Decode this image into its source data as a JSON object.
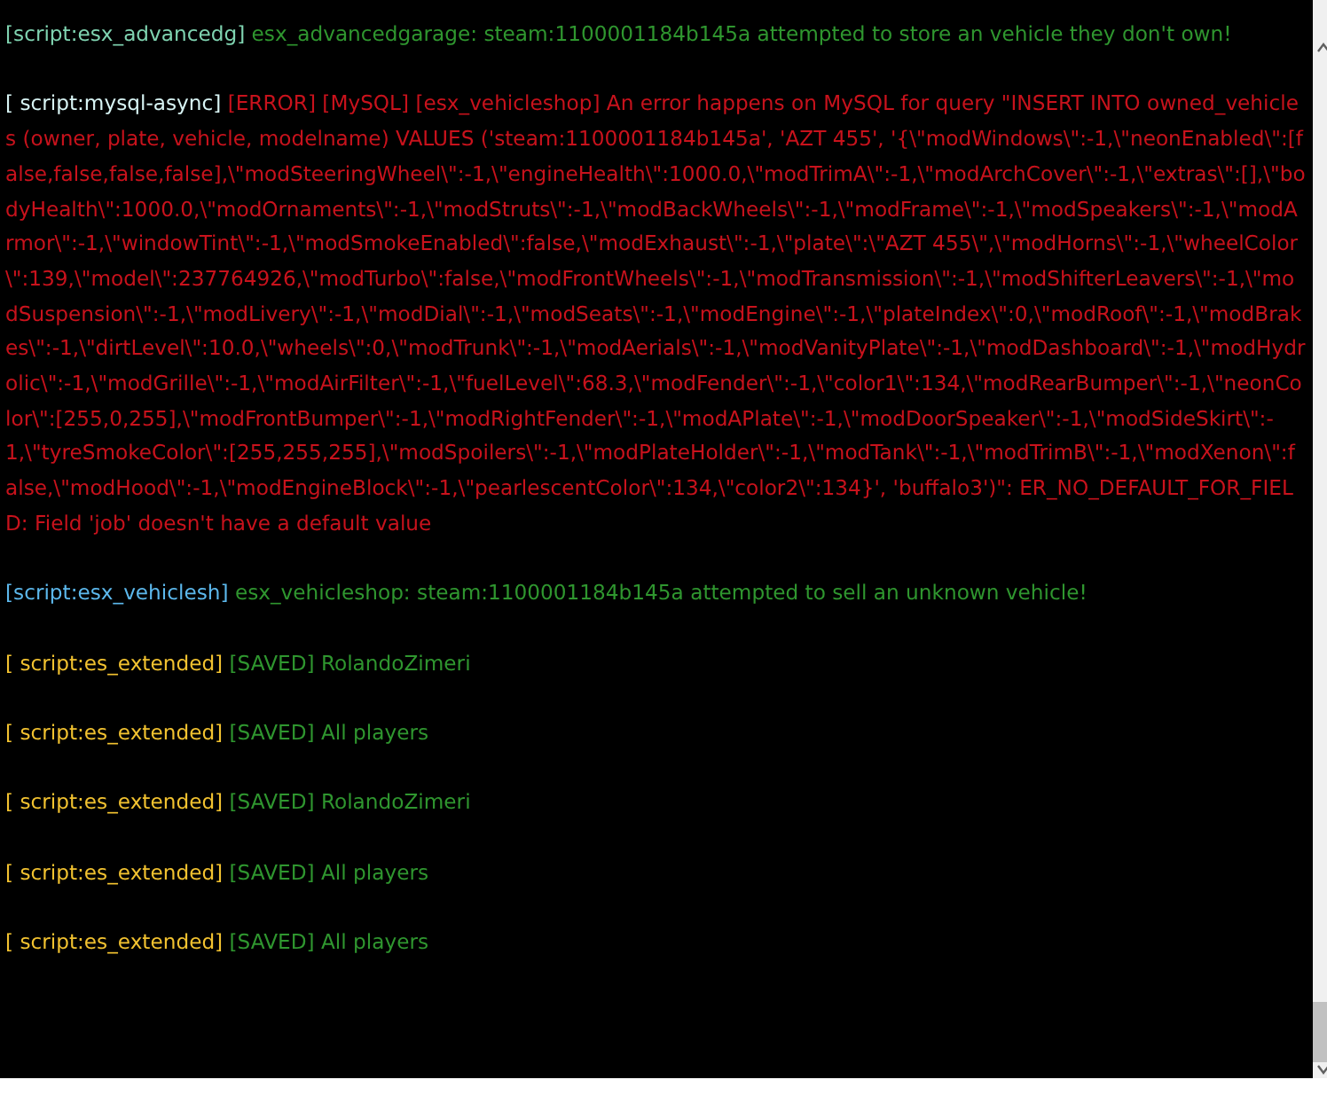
{
  "entries": [
    {
      "tag": {
        "text": "[script:esx_advancedg]",
        "color": "#7fd3b0"
      },
      "message": {
        "text": "esx_advancedgarage: steam:1100001184b145a attempted to store an vehicle they don't own!",
        "color": "#2f962f"
      }
    },
    {
      "tag": {
        "text": "[ script:mysql-async]",
        "color": "#d8f4f4"
      },
      "message": {
        "text": "[ERROR] [MySQL] [esx_vehicleshop] An error happens on MySQL for query \"INSERT INTO owned_vehicles (owner, plate, vehicle, modelname) VALUES ('steam:1100001184b145a', 'AZT 455', '{\\\"modWindows\\\":-1,\\\"neonEnabled\\\":[false,false,false,false],\\\"modSteeringWheel\\\":-1,\\\"engineHealth\\\":1000.0,\\\"modTrimA\\\":-1,\\\"modArchCover\\\":-1,\\\"extras\\\":[],\\\"bodyHealth\\\":1000.0,\\\"modOrnaments\\\":-1,\\\"modStruts\\\":-1,\\\"modBackWheels\\\":-1,\\\"modFrame\\\":-1,\\\"modSpeakers\\\":-1,\\\"modArmor\\\":-1,\\\"windowTint\\\":-1,\\\"modSmokeEnabled\\\":false,\\\"modExhaust\\\":-1,\\\"plate\\\":\\\"AZT 455\\\",\\\"modHorns\\\":-1,\\\"wheelColor\\\":139,\\\"model\\\":237764926,\\\"modTurbo\\\":false,\\\"modFrontWheels\\\":-1,\\\"modTransmission\\\":-1,\\\"modShifterLeavers\\\":-1,\\\"modSuspension\\\":-1,\\\"modLivery\\\":-1,\\\"modDial\\\":-1,\\\"modSeats\\\":-1,\\\"modEngine\\\":-1,\\\"plateIndex\\\":0,\\\"modRoof\\\":-1,\\\"modBrakes\\\":-1,\\\"dirtLevel\\\":10.0,\\\"wheels\\\":0,\\\"modTrunk\\\":-1,\\\"modAerials\\\":-1,\\\"modVanityPlate\\\":-1,\\\"modDashboard\\\":-1,\\\"modHydrolic\\\":-1,\\\"modGrille\\\":-1,\\\"modAirFilter\\\":-1,\\\"fuelLevel\\\":68.3,\\\"modFender\\\":-1,\\\"color1\\\":134,\\\"modRearBumper\\\":-1,\\\"neonColor\\\":[255,0,255],\\\"modFrontBumper\\\":-1,\\\"modRightFender\\\":-1,\\\"modAPlate\\\":-1,\\\"modDoorSpeaker\\\":-1,\\\"modSideSkirt\\\":-1,\\\"tyreSmokeColor\\\":[255,255,255],\\\"modSpoilers\\\":-1,\\\"modPlateHolder\\\":-1,\\\"modTank\\\":-1,\\\"modTrimB\\\":-1,\\\"modXenon\\\":false,\\\"modHood\\\":-1,\\\"modEngineBlock\\\":-1,\\\"pearlescentColor\\\":134,\\\"color2\\\":134}', 'buffalo3')\": ER_NO_DEFAULT_FOR_FIELD: Field 'job' doesn't have a default value",
        "color": "#c8121c"
      }
    },
    {
      "tag": {
        "text": "[script:esx_vehiclesh]",
        "color": "#5cb8ec"
      },
      "message": {
        "text": "esx_vehicleshop: steam:1100001184b145a attempted to sell an unknown vehicle!",
        "color": "#2f962f"
      }
    },
    {
      "tag": {
        "text": "[ script:es_extended]",
        "color": "#f2c230"
      },
      "message": {
        "text": "[SAVED] RolandoZimeri",
        "color": "#2f962f"
      }
    },
    {
      "tag": {
        "text": "[ script:es_extended]",
        "color": "#f2c230"
      },
      "message": {
        "text": "[SAVED] All players",
        "color": "#2f962f"
      }
    },
    {
      "tag": {
        "text": "[ script:es_extended]",
        "color": "#f2c230"
      },
      "message": {
        "text": "[SAVED] RolandoZimeri",
        "color": "#2f962f"
      }
    },
    {
      "tag": {
        "text": "[ script:es_extended]",
        "color": "#f2c230"
      },
      "message": {
        "text": "[SAVED] All players",
        "color": "#2f962f"
      }
    },
    {
      "tag": {
        "text": "[ script:es_extended]",
        "color": "#f2c230"
      },
      "message": {
        "text": "[SAVED] All players",
        "color": "#2f962f"
      }
    }
  ]
}
